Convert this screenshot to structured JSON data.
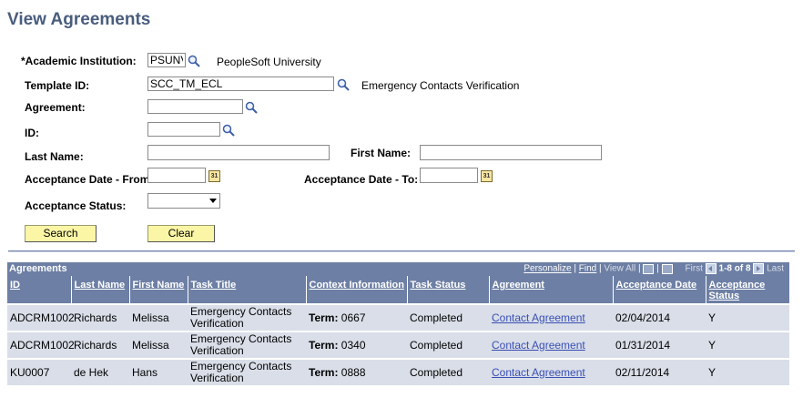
{
  "page": {
    "title": "View Agreements"
  },
  "form": {
    "institution": {
      "label": "*Academic Institution:",
      "value": "PSUNV",
      "desc": "PeopleSoft University"
    },
    "template": {
      "label": "Template ID:",
      "value": "SCC_TM_ECL",
      "desc": "Emergency Contacts Verification"
    },
    "agreement": {
      "label": "Agreement:",
      "value": ""
    },
    "id": {
      "label": "ID:",
      "value": ""
    },
    "last_name": {
      "label": "Last Name:",
      "value": ""
    },
    "first_name": {
      "label": "First Name:",
      "value": ""
    },
    "date_from": {
      "label": "Acceptance Date - From:",
      "value": ""
    },
    "date_to": {
      "label": "Acceptance Date - To:",
      "value": ""
    },
    "status": {
      "label": "Acceptance Status:",
      "value": ""
    },
    "search_label": "Search",
    "clear_label": "Clear",
    "calendar_text": "31"
  },
  "grid": {
    "title": "Agreements",
    "personalize": "Personalize",
    "find": "Find",
    "view_all": "View All",
    "first": "First",
    "range": "1-8 of 8",
    "last": "Last",
    "columns": [
      "ID",
      "Last Name",
      "First Name",
      "Task Title",
      "Context Information",
      "Task Status",
      "Agreement",
      "Acceptance Date",
      "Acceptance Status"
    ],
    "rows": [
      {
        "id": "ADCRM1002",
        "last": "Richards",
        "first": "Melissa",
        "task": "Emergency Contacts Verification",
        "ctx_label": "Term:",
        "ctx_value": "0667",
        "status": "Completed",
        "agreement": "Contact Agreement",
        "date": "02/04/2014",
        "accepted": "Y"
      },
      {
        "id": "ADCRM1002",
        "last": "Richards",
        "first": "Melissa",
        "task": "Emergency Contacts Verification",
        "ctx_label": "Term:",
        "ctx_value": "0340",
        "status": "Completed",
        "agreement": "Contact Agreement",
        "date": "01/31/2014",
        "accepted": "Y"
      },
      {
        "id": "KU0007",
        "last": "de Hek",
        "first": "Hans",
        "task": "Emergency Contacts Verification",
        "ctx_label": "Term:",
        "ctx_value": "0888",
        "status": "Completed",
        "agreement": "Contact Agreement",
        "date": "02/11/2014",
        "accepted": "Y"
      }
    ]
  }
}
